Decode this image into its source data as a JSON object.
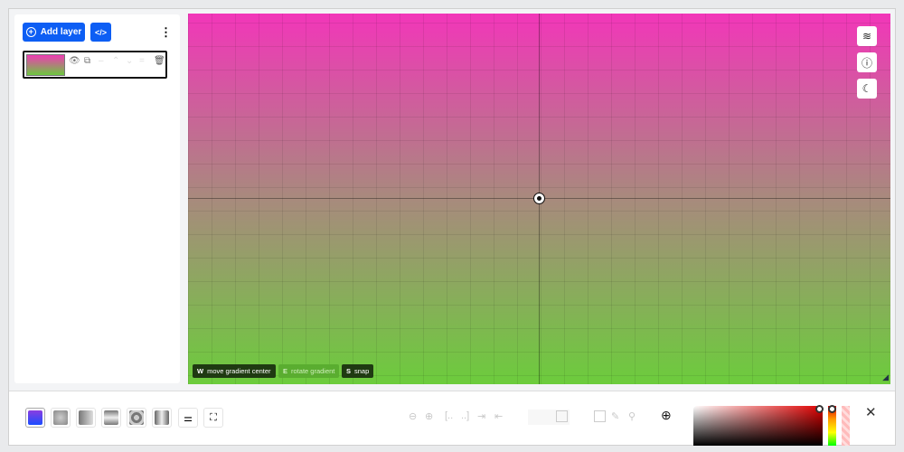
{
  "sidebar": {
    "add_layer_label": "Add layer",
    "code_icon": "</>",
    "more_icon": "⋮",
    "layer": {
      "icons": [
        "eye-icon",
        "duplicate-icon",
        "move-up-icon",
        "move-down-icon",
        "merge-icon",
        "trash-icon"
      ]
    }
  },
  "canvas": {
    "gradient_top": "#f236b9",
    "gradient_bottom": "#6ccc3c",
    "hints": [
      {
        "key": "W",
        "label": "move gradient center"
      },
      {
        "key": "E",
        "label": "rotate gradient"
      },
      {
        "key": "S",
        "label": "snap"
      }
    ],
    "side_buttons": [
      "layers-icon",
      "help-icon",
      "moon-icon"
    ]
  },
  "toolbar": {
    "gradient_types": [
      "linear",
      "radial",
      "conic",
      "repeating-linear",
      "repeating-radial",
      "repeating-conic"
    ],
    "color": {
      "hue_color": "#e00000"
    },
    "close_icon": "✕"
  }
}
